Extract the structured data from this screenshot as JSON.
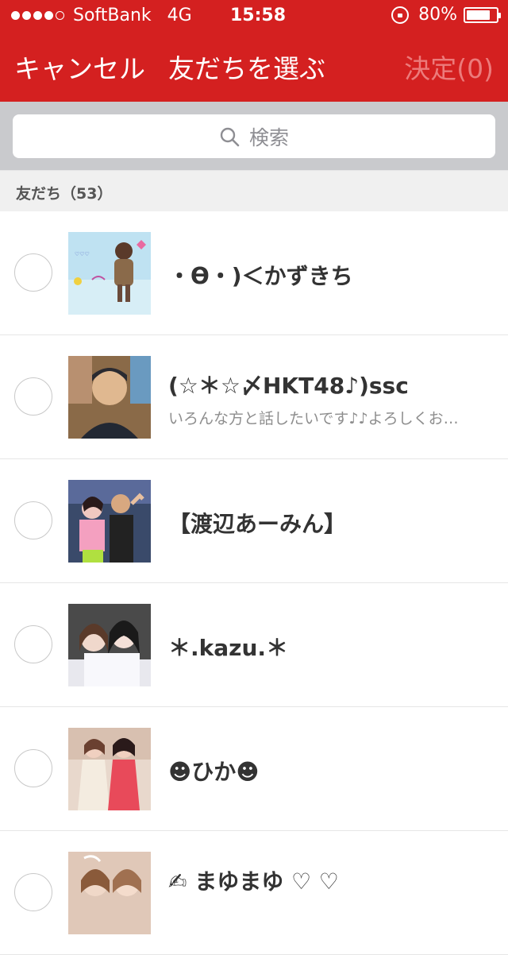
{
  "status_bar": {
    "carrier": "SoftBank",
    "network": "4G",
    "time": "15:58",
    "battery": "80%",
    "battery_level": 0.8,
    "signal_bars_filled": 4,
    "signal_bars_total": 5
  },
  "nav": {
    "cancel_label": "キャンセル",
    "title": "友だちを選ぶ",
    "confirm_label": "決定(0)"
  },
  "search": {
    "placeholder": "検索"
  },
  "section": {
    "label": "友だち（53）"
  },
  "friends": [
    {
      "name": "・ϴ・)＜かずきち",
      "status": ""
    },
    {
      "name": "(☆＊☆〆HKT48♪)ssc",
      "status": "いろんな方と話したいです♪♪よろしくお…"
    },
    {
      "name": "【渡辺あーみん】",
      "status": ""
    },
    {
      "name": "＊.kazu.＊",
      "status": ""
    },
    {
      "name": "☻ひか☻",
      "status": ""
    },
    {
      "name": "✍ まゆまゆ ♡ ♡",
      "status": ""
    }
  ],
  "colors": {
    "header": "#d42020",
    "confirm_disabled": "#ec7b7b",
    "search_bg": "#c9cacd",
    "section_bg": "#f0f0f0"
  }
}
